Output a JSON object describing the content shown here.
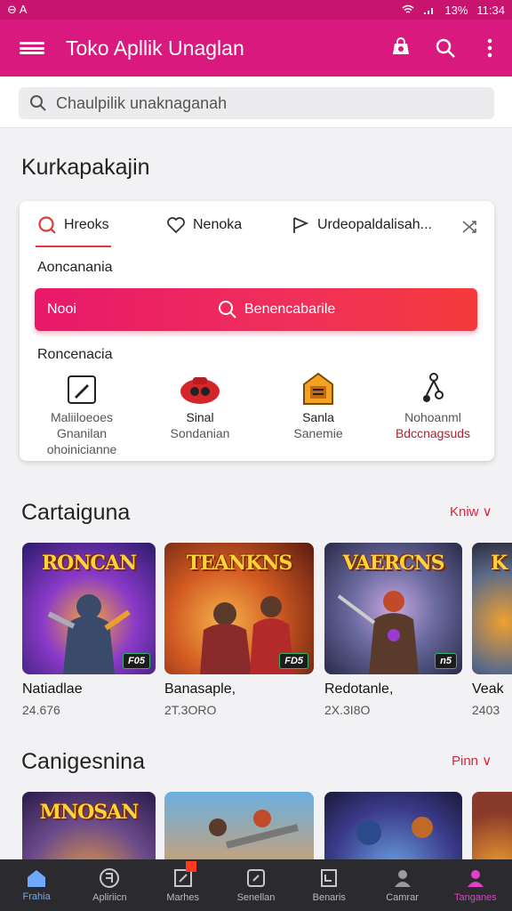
{
  "status": {
    "left": "⊖ A",
    "right": "13%",
    "time": "11:34"
  },
  "appbar": {
    "title": "Toko Apllik Unaglan"
  },
  "search": {
    "placeholder": "Chaulpilik unaknaganah"
  },
  "section1": {
    "title": "Kurkapakajin"
  },
  "card": {
    "tabs": [
      {
        "label": "Hreoks",
        "icon": "search-icon"
      },
      {
        "label": "Nenoka",
        "icon": "heart-icon"
      },
      {
        "label": "Urdeopaldalisah...",
        "icon": "flag-icon"
      }
    ],
    "label1": "Aoncanania",
    "button_left": "Nooi",
    "button_center": "Benencabarile",
    "label2": "Roncenacia",
    "categories": [
      {
        "name": "Maliiloeoes",
        "sub": "Gnanilan",
        "sub2": "ohoinicianne",
        "icon": "pen-icon"
      },
      {
        "name": "Sinal",
        "sub": "Sondanian",
        "icon": "car-icon"
      },
      {
        "name": "Sanla",
        "sub": "Sanemie",
        "icon": "chest-icon"
      },
      {
        "name": "Nohoanml",
        "sub": "Bdccnagsuds",
        "icon": "music-icon"
      }
    ]
  },
  "section2": {
    "title": "Cartaiguna",
    "more": "Kniw"
  },
  "row1": [
    {
      "name": "Natiadlae",
      "count": "24.676",
      "thumb_title": "RONCAN",
      "badge": "F05"
    },
    {
      "name": "Banasaple,",
      "count": "2T.3ORO",
      "thumb_title": "TEANKNS",
      "badge": "FD5"
    },
    {
      "name": "Redotanle,",
      "count": "2X.3I8O",
      "thumb_title": "VAERCNS",
      "badge": "n5"
    },
    {
      "name": "Veak",
      "count": "2403",
      "thumb_title": "K",
      "badge": ""
    }
  ],
  "section3": {
    "title": "Canigesnina",
    "more": "Pinn"
  },
  "row2": [
    {
      "thumb_title": "MNOSAN"
    },
    {
      "thumb_title": ""
    },
    {
      "thumb_title": ""
    },
    {
      "thumb_title": ""
    }
  ],
  "nav": [
    {
      "label": "Frahia",
      "icon": "home-icon"
    },
    {
      "label": "Apliriicn",
      "icon": "apps-icon"
    },
    {
      "label": "Marhes",
      "icon": "movie-icon"
    },
    {
      "label": "Senellan",
      "icon": "book-icon"
    },
    {
      "label": "Benaris",
      "icon": "tablet-icon"
    },
    {
      "label": "Camrar",
      "icon": "person-icon"
    },
    {
      "label": "Tanganes",
      "icon": "profile-icon"
    }
  ],
  "colors": {
    "brand": "#d9197d",
    "accent": "#f0305a",
    "nav_bg": "#2b2b2f"
  }
}
